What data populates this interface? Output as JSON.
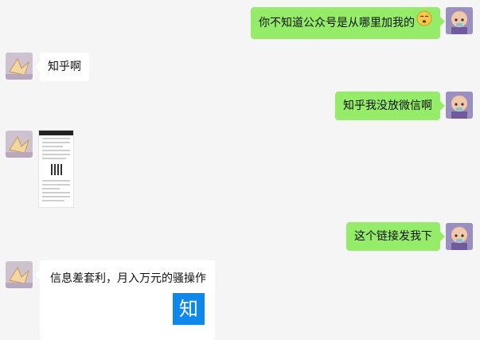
{
  "messages": [
    {
      "side": "right",
      "text": "你不知道公众号是从哪里加我的",
      "emoji": "pensive-emoji"
    },
    {
      "side": "left",
      "text": "知乎啊"
    },
    {
      "side": "right",
      "text": "知乎我没放微信啊"
    },
    {
      "side": "left",
      "type": "image",
      "content": "screenshot-thumbnail"
    },
    {
      "side": "right",
      "text": "这个链接发我下"
    },
    {
      "side": "left",
      "type": "link-card",
      "title": "信息差套利，月入万元的骚操作",
      "logo": "知"
    }
  ],
  "colors": {
    "background": "#f5f5f5",
    "sent_bubble": "#95ec69",
    "received_bubble": "#ffffff",
    "zhihu_blue": "#0f88eb"
  }
}
